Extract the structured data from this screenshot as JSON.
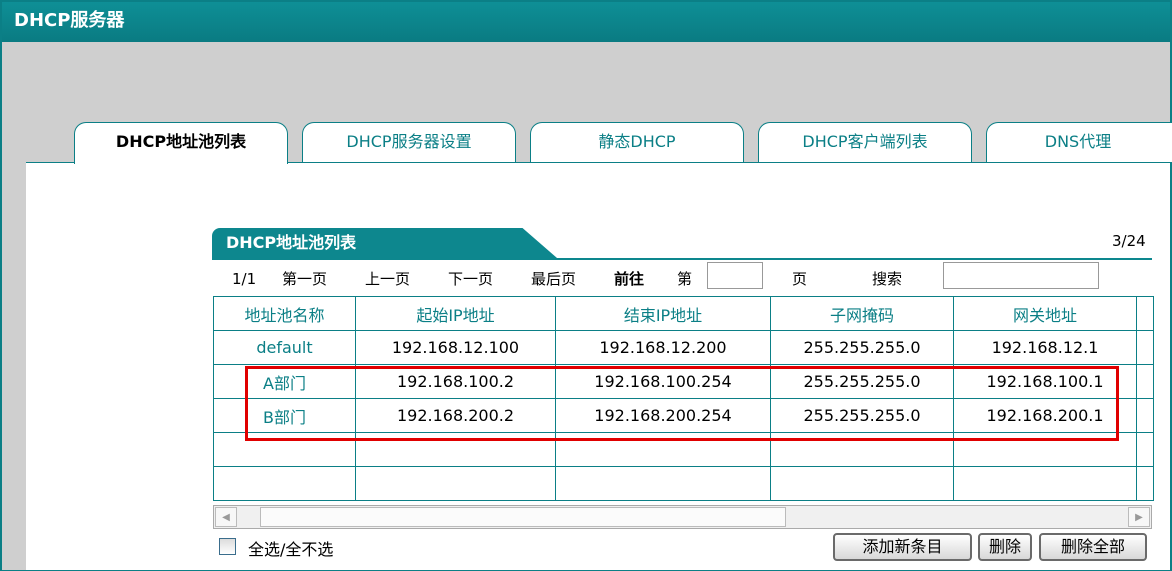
{
  "window": {
    "title": "DHCP服务器"
  },
  "tabs": [
    {
      "label": "DHCP地址池列表",
      "active": true
    },
    {
      "label": "DHCP服务器设置",
      "active": false
    },
    {
      "label": "静态DHCP",
      "active": false
    },
    {
      "label": "DHCP客户端列表",
      "active": false
    },
    {
      "label": "DNS代理",
      "active": false
    }
  ],
  "section": {
    "title": "DHCP地址池列表",
    "page_count": "3/24"
  },
  "pager": {
    "current": "1/1",
    "first": "第一页",
    "prev": "上一页",
    "next": "下一页",
    "last": "最后页",
    "goto": "前往",
    "page_prefix": "第",
    "page_suffix": "页",
    "search": "搜索"
  },
  "table": {
    "columns": [
      "地址池名称",
      "起始IP地址",
      "结束IP地址",
      "子网掩码",
      "网关地址"
    ],
    "rows": [
      [
        "default",
        "192.168.12.100",
        "192.168.12.200",
        "255.255.255.0",
        "192.168.12.1"
      ],
      [
        "A部门",
        "192.168.100.2",
        "192.168.100.254",
        "255.255.255.0",
        "192.168.100.1"
      ],
      [
        "B部门",
        "192.168.200.2",
        "192.168.200.254",
        "255.255.255.0",
        "192.168.200.1"
      ],
      [
        "",
        "",
        "",
        "",
        ""
      ],
      [
        "",
        "",
        "",
        "",
        ""
      ]
    ]
  },
  "footer": {
    "select_all": "全选/全不选",
    "add_button": "添加新条目",
    "delete_button": "删除",
    "delete_all_button": "删除全部"
  },
  "icons": {
    "scroll_left": "scroll-left-icon",
    "scroll_right": "scroll-right-icon"
  },
  "colors": {
    "accent": "#0b7f86",
    "highlight": "#e00000"
  }
}
